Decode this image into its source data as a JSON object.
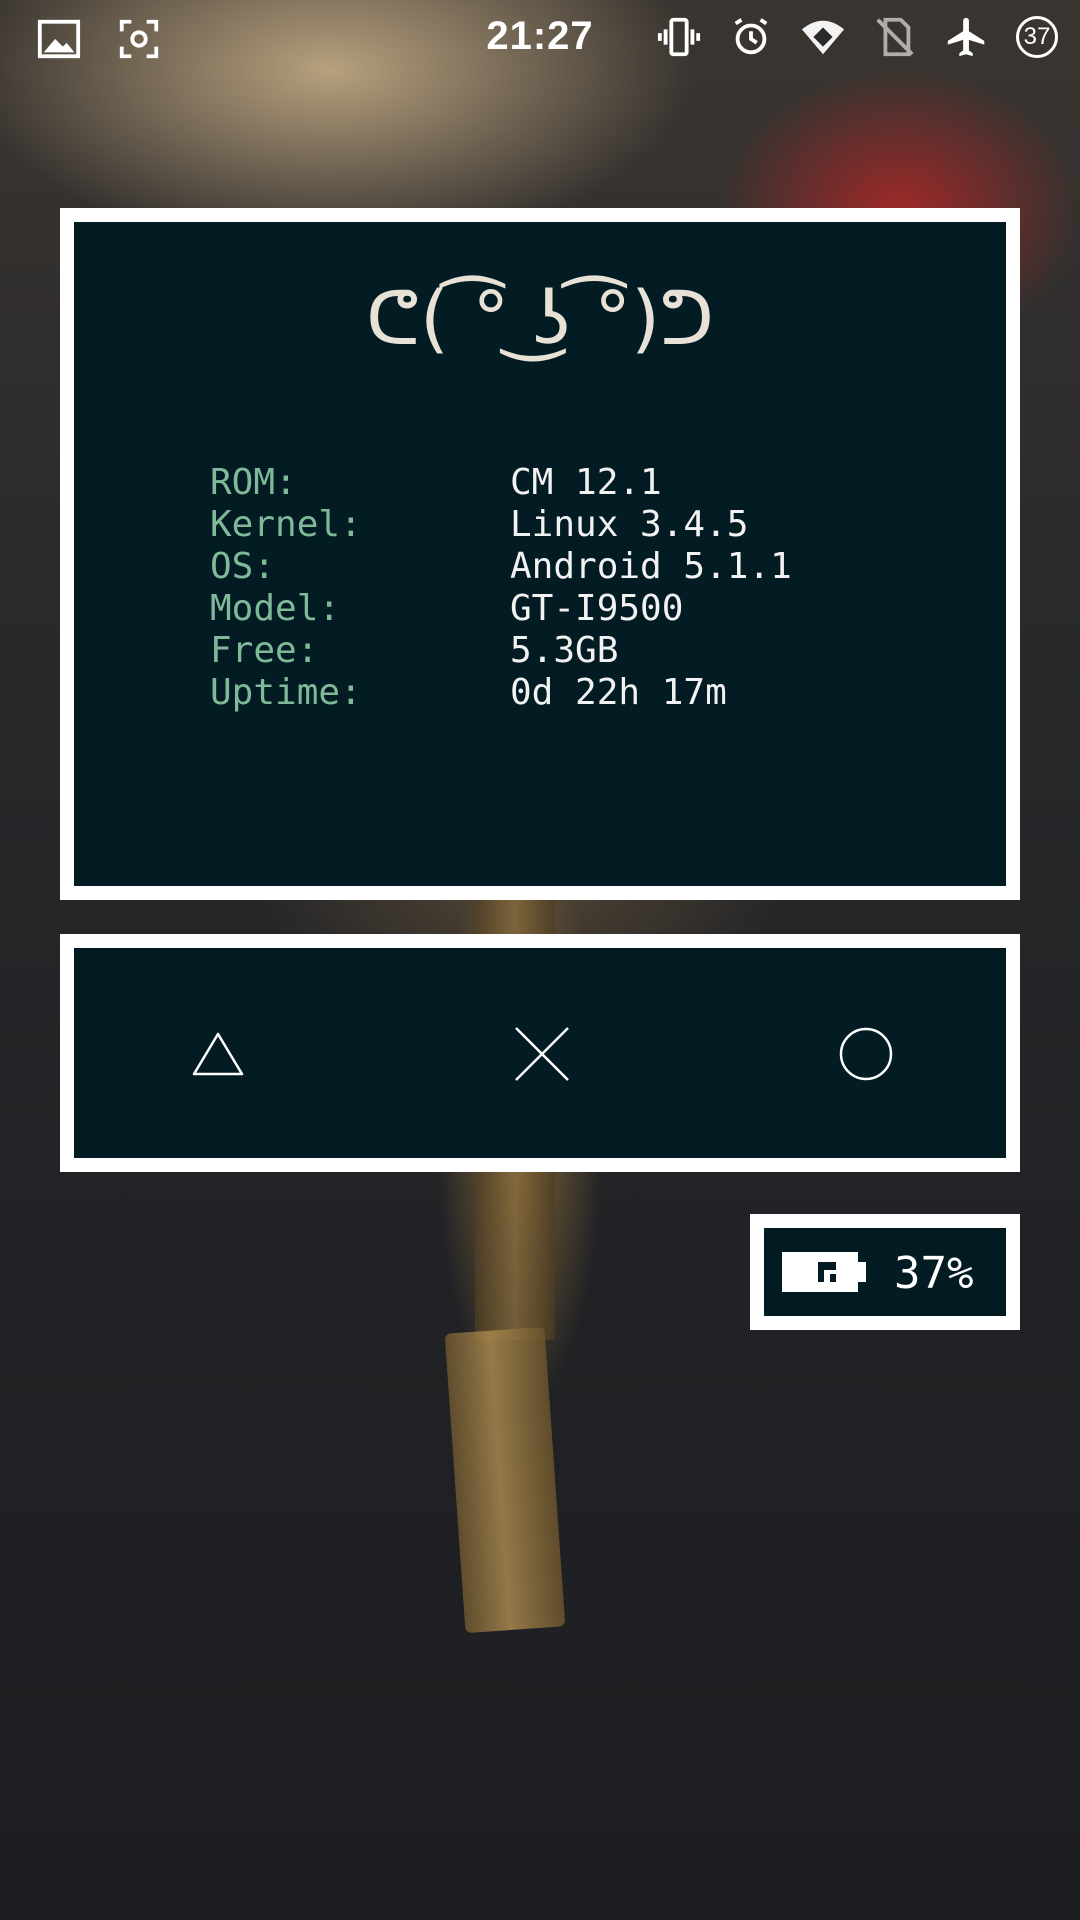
{
  "status_bar": {
    "time": "21:27",
    "left_icons": [
      "image-icon",
      "screenshot-icon"
    ],
    "right_icons": [
      "vibrate-icon",
      "alarm-icon",
      "wifi-icon",
      "no-sim-icon",
      "airplane-icon"
    ],
    "battery_level": "37"
  },
  "info_widget": {
    "face": "ᕦ( ͡° ͜ʖ ͡°)ᕤ",
    "rows": [
      {
        "key": "ROM:",
        "value": "CM 12.1"
      },
      {
        "key": "Kernel:",
        "value": "Linux 3.4.5"
      },
      {
        "key": "OS:",
        "value": "Android 5.1.1"
      },
      {
        "key": "Model:",
        "value": "GT-I9500"
      },
      {
        "key": "Free:",
        "value": "5.3GB"
      },
      {
        "key": "Uptime:",
        "value": "0d 22h 17m"
      }
    ]
  },
  "nav_widget": {
    "buttons": [
      "triangle-icon",
      "cross-icon",
      "circle-icon"
    ]
  },
  "battery_widget": {
    "percent_text": "37%",
    "level": 0.37
  },
  "colors": {
    "widget_bg": "#031b22",
    "widget_border": "#ffffff",
    "key_text": "#80b99a",
    "value_text": "#f2f2f2"
  }
}
